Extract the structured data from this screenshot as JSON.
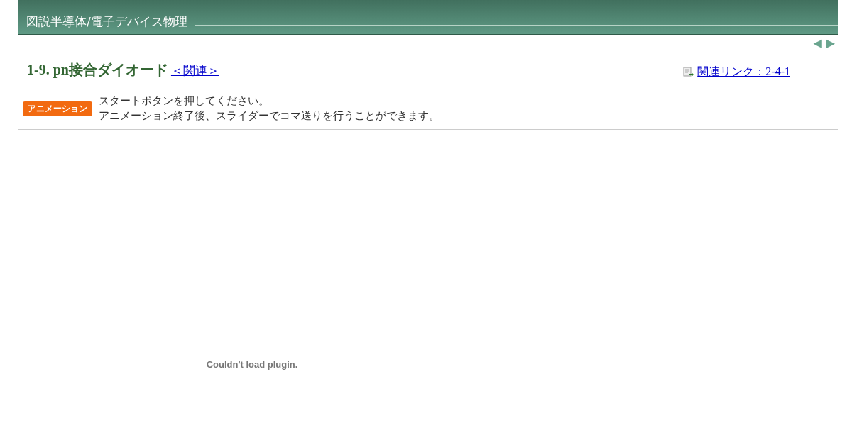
{
  "header": {
    "title": "図説半導体/電子デバイス物理"
  },
  "nav": {
    "prev": "◀",
    "next": "▶"
  },
  "heading": {
    "title": "1-9. pn接合ダイオード",
    "related": "＜関連＞",
    "related_link": "関連リンク：2-4-1"
  },
  "notice": {
    "badge": "アニメーション",
    "lines": [
      "スタートボタンを押してください。",
      "アニメーション終了後、スライダーでコマ送りを行うことができます。"
    ]
  },
  "plugin": {
    "message": "Couldn't load plugin."
  }
}
